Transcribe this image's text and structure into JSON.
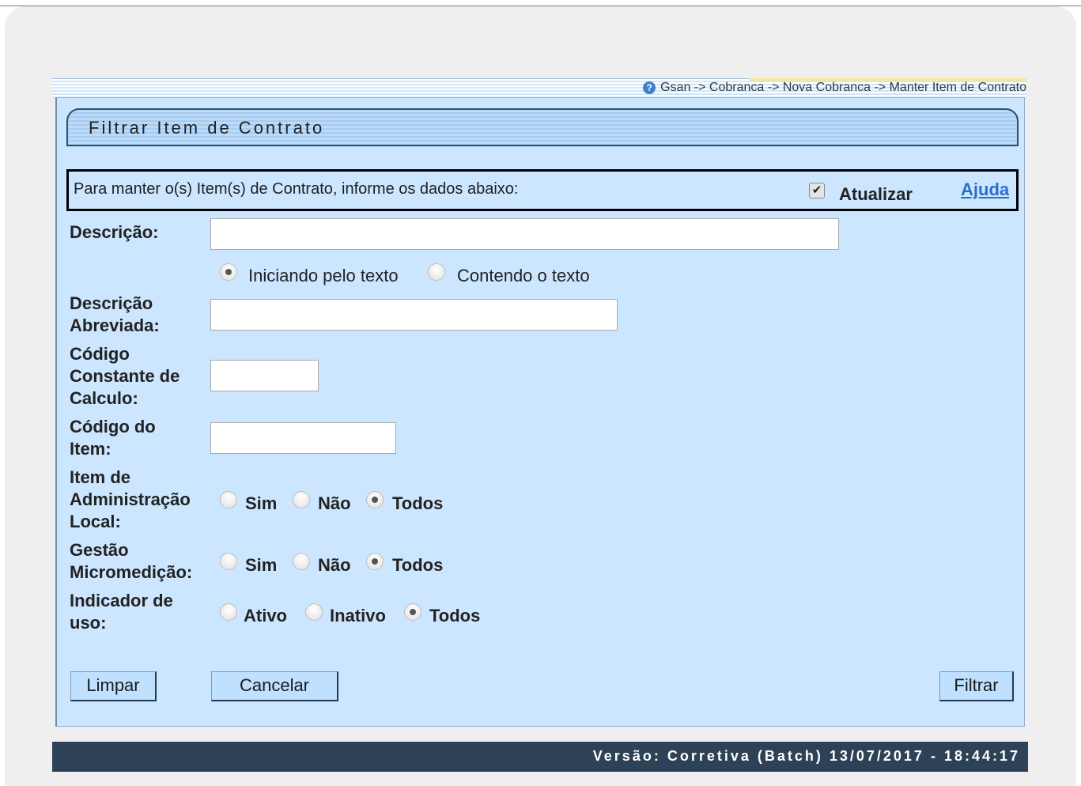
{
  "breadcrumb": "Gsan -> Cobranca -> Nova Cobranca -> Manter Item de Contrato",
  "title": "Filtrar Item de Contrato",
  "instruction": "Para manter o(s) Item(s) de Contrato, informe os dados abaixo:",
  "atualizar": {
    "label": "Atualizar",
    "checked": true
  },
  "help_link": "Ajuda",
  "form": {
    "descricao": {
      "label": "Descrição:",
      "value": ""
    },
    "match": {
      "options": [
        "Iniciando pelo texto",
        "Contendo o texto"
      ],
      "selected": "Iniciando pelo texto"
    },
    "descricao_abreviada": {
      "label_1": "Descrição",
      "label_2": "Abreviada:",
      "value": ""
    },
    "codigo_constante": {
      "label_1": "Código",
      "label_2": "Constante de",
      "label_3": "Calculo:",
      "value": ""
    },
    "codigo_item": {
      "label_1": "Código do",
      "label_2": "Item:",
      "value": ""
    },
    "item_admin_local": {
      "label_1": "Item de",
      "label_2": "Administração",
      "label_3": "Local:",
      "options": [
        "Sim",
        "Não",
        "Todos"
      ],
      "selected": "Todos"
    },
    "gestao_micromedicao": {
      "label_1": "Gestão",
      "label_2": "Micromedição:",
      "options": [
        "Sim",
        "Não",
        "Todos"
      ],
      "selected": "Todos"
    },
    "indicador_uso": {
      "label_1": "Indicador de",
      "label_2": "uso:",
      "options": [
        "Ativo",
        "Inativo",
        "Todos"
      ],
      "selected": "Todos"
    }
  },
  "buttons": {
    "limpar": "Limpar",
    "cancelar": "Cancelar",
    "filtrar": "Filtrar"
  },
  "version": "Versão: Corretiva (Batch) 13/07/2017 - 18:44:17"
}
